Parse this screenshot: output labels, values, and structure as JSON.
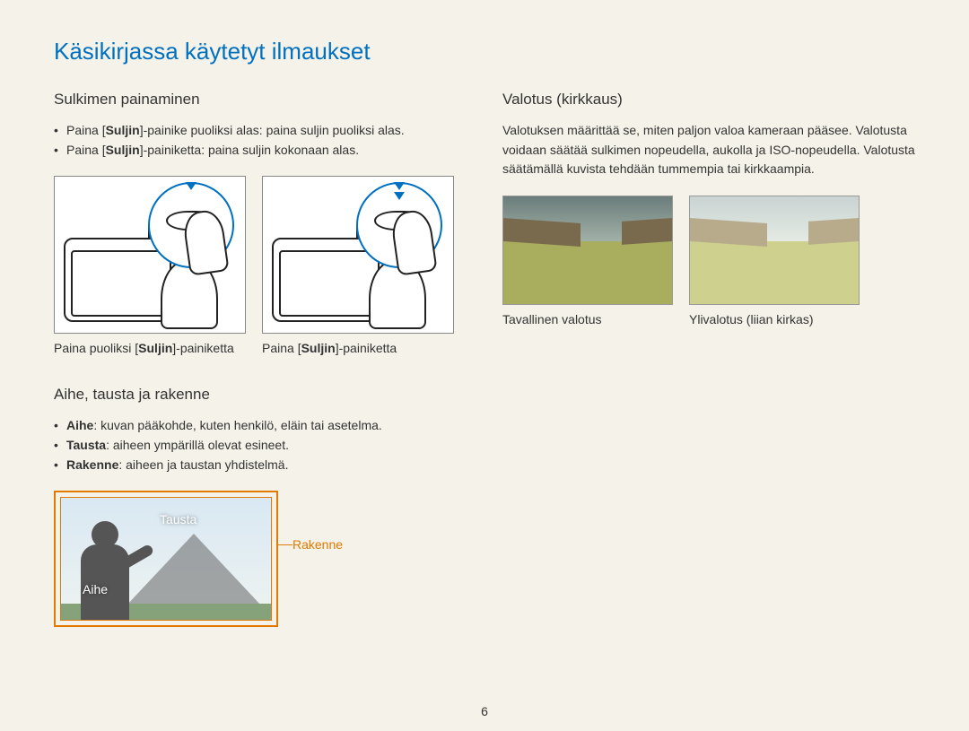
{
  "page": {
    "title": "Käsikirjassa käytetyt ilmaukset",
    "number": "6"
  },
  "left": {
    "section1": {
      "heading": "Sulkimen painaminen",
      "bullets": [
        {
          "pre": "Paina [",
          "bold": "Suljin",
          "post": "]-painike puoliksi alas: paina suljin puoliksi alas."
        },
        {
          "pre": "Paina [",
          "bold": "Suljin",
          "post": "]-painiketta: paina suljin kokonaan alas."
        }
      ],
      "figures": [
        {
          "cap_pre": "Paina puoliksi [",
          "cap_bold": "Suljin",
          "cap_post": "]-painiketta"
        },
        {
          "cap_pre": "Paina [",
          "cap_bold": "Suljin",
          "cap_post": "]-painiketta"
        }
      ]
    },
    "section2": {
      "heading": "Aihe, tausta ja rakenne",
      "bullets": [
        {
          "bold": "Aihe",
          "post": ": kuvan pääkohde, kuten henkilö, eläin tai asetelma."
        },
        {
          "bold": "Tausta",
          "post": ": aiheen ympärillä olevat esineet."
        },
        {
          "bold": "Rakenne",
          "post": ": aiheen ja taustan yhdistelmä."
        }
      ],
      "labels": {
        "tausta": "Tausta",
        "aihe": "Aihe",
        "rakenne": "Rakenne"
      }
    }
  },
  "right": {
    "heading": "Valotus (kirkkaus)",
    "para": "Valotuksen määrittää se, miten paljon valoa kameraan pääsee. Valotusta voidaan säätää sulkimen nopeudella, aukolla ja ISO-nopeudella. Valotusta säätämällä kuvista tehdään tummempia tai kirkkaampia.",
    "captions": {
      "normal": "Tavallinen valotus",
      "over": "Ylivalotus (liian kirkas)"
    }
  }
}
